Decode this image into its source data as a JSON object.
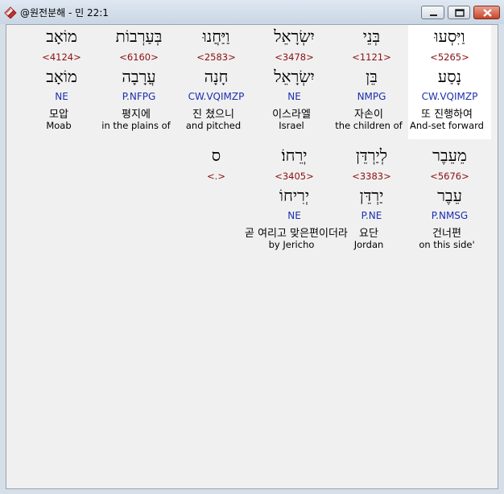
{
  "window": {
    "title": "@원전분해 - 민 22:1"
  },
  "colors": {
    "strong_number": "#8b1010",
    "morphology": "#1c2fb0",
    "selected_background": "#ffffff"
  },
  "rows": [
    {
      "words": [
        {
          "surface": "וַיִּסְעוּ",
          "strong": "<5265>",
          "lemma": "נָסַע",
          "morph": "CW.VQIMZP",
          "korean": "또 진행하여",
          "english": "And-set forward",
          "selected": true
        },
        {
          "surface": "בְּנֵי",
          "strong": "<1121>",
          "lemma": "בֵּן",
          "morph": "NMPG",
          "korean": "자손이",
          "english": "the children of",
          "selected": false
        },
        {
          "surface": "יִשְׂרָאֵל",
          "strong": "<3478>",
          "lemma": "יִשְׂרָאֵל",
          "morph": "NE",
          "korean": "이스라엘",
          "english": "Israel",
          "selected": false
        },
        {
          "surface": "וַיַּחֲנוּ",
          "strong": "<2583>",
          "lemma": "חָנָה",
          "morph": "CW.VQIMZP",
          "korean": "진 쳤으니",
          "english": "and pitched",
          "selected": false
        },
        {
          "surface": "בְּעַרְבוֹת",
          "strong": "<6160>",
          "lemma": "עֲרָבָה",
          "morph": "P.NFPG",
          "korean": "평지에",
          "english": "in the plains of",
          "selected": false
        },
        {
          "surface": "מוֹאָב",
          "strong": "<4124>",
          "lemma": "מוֹאָב",
          "morph": "NE",
          "korean": "모압",
          "english": "Moab",
          "selected": false
        }
      ]
    },
    {
      "words": [
        {
          "surface": "מֵעֵבֶר",
          "strong": "<5676>",
          "lemma": "עֵבֶר",
          "morph": "P.NMSG",
          "korean": "건너편",
          "english": "on this side'",
          "selected": false
        },
        {
          "surface": "לְיַרְדֵּן",
          "strong": "<3383>",
          "lemma": "יַרְדֵּן",
          "morph": "P.NE",
          "korean": "요단",
          "english": "Jordan",
          "selected": false
        },
        {
          "surface": "יְרֵחוֹ׃",
          "strong": "<3405>",
          "lemma": "יְרִיחוֹ",
          "morph": "NE",
          "korean": "곧 여리고 맞은편이더라",
          "english": "by Jericho",
          "selected": false
        },
        {
          "surface": "ס",
          "strong": "<.>",
          "lemma": "",
          "morph": "",
          "korean": "",
          "english": "",
          "selected": false
        }
      ]
    }
  ]
}
